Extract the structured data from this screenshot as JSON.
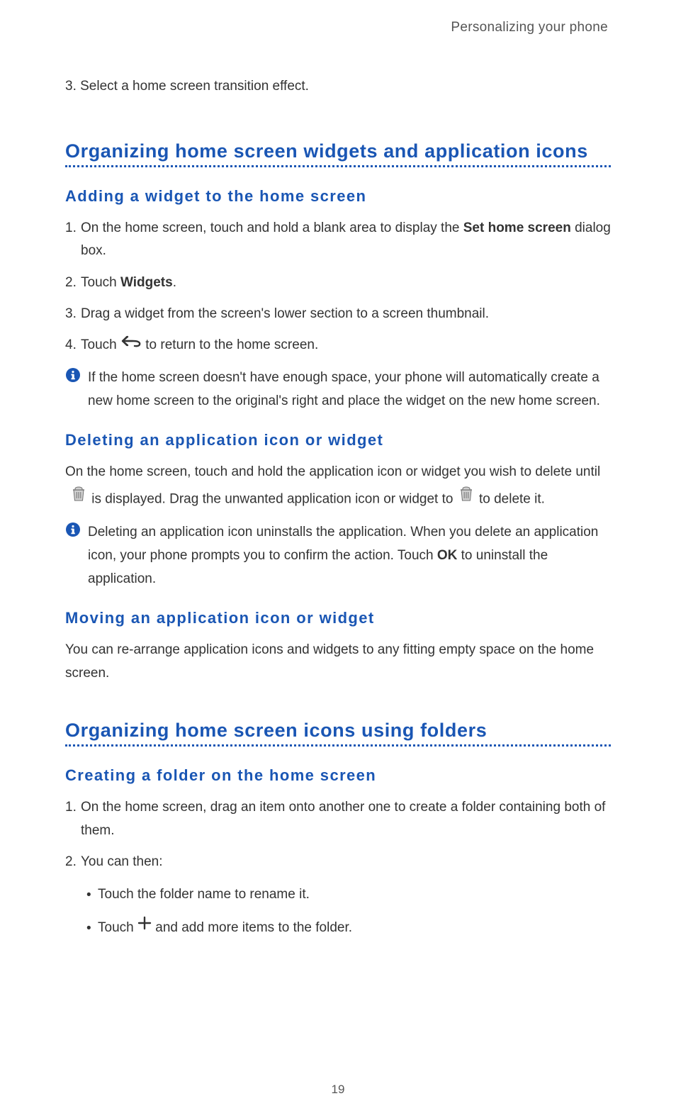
{
  "header": {
    "chapter": "Personalizing your phone"
  },
  "intro_step": "3. Select a home screen transition effect.",
  "section1": {
    "title": "Organizing home screen widgets and application icons",
    "sub1": {
      "title": "Adding a widget to the home screen",
      "items": [
        {
          "num": "1.",
          "pre": "On the home screen, touch and hold a blank area to display the ",
          "bold": "Set home screen",
          "post": " dialog box."
        },
        {
          "num": "2.",
          "pre": "Touch ",
          "bold": "Widgets",
          "post": "."
        },
        {
          "num": "3.",
          "plain": "Drag a widget from the screen's lower section to a screen thumbnail."
        },
        {
          "num": "4.",
          "touch_back": true,
          "pre": "Touch ",
          "post": "to return to the home screen."
        }
      ],
      "info": "If the home screen doesn't have enough space, your phone will automatically create a new home screen to the original's right and place the widget on the new home screen."
    },
    "sub2": {
      "title": "Deleting an application icon or widget",
      "lead": "On the home screen, touch and hold the application icon or widget you wish to delete until",
      "line2_pre": " is displayed. Drag the unwanted application icon or widget to ",
      "line2_post": " to delete it.",
      "info_pre": "Deleting an application icon uninstalls the application. When you delete an application icon, your phone prompts you to confirm the action. Touch ",
      "info_bold": "OK",
      "info_post": " to uninstall the application."
    },
    "sub3": {
      "title": "Moving an application icon or widget",
      "text": "You can re-arrange application icons and widgets to any fitting empty space on the home screen."
    }
  },
  "section2": {
    "title": "Organizing home screen icons using folders",
    "sub1": {
      "title": "Creating a folder on the home screen",
      "items": [
        {
          "num": "1.",
          "plain": "On the home screen, drag an item onto another one to create a folder containing both of them."
        },
        {
          "num": "2.",
          "plain": "You can then:"
        }
      ],
      "bullets": [
        {
          "pre": "Touch the folder name to rename it."
        },
        {
          "plus": true,
          "pre": "Touch ",
          "post": " and add more items to the folder."
        }
      ]
    }
  },
  "page_number": "19"
}
